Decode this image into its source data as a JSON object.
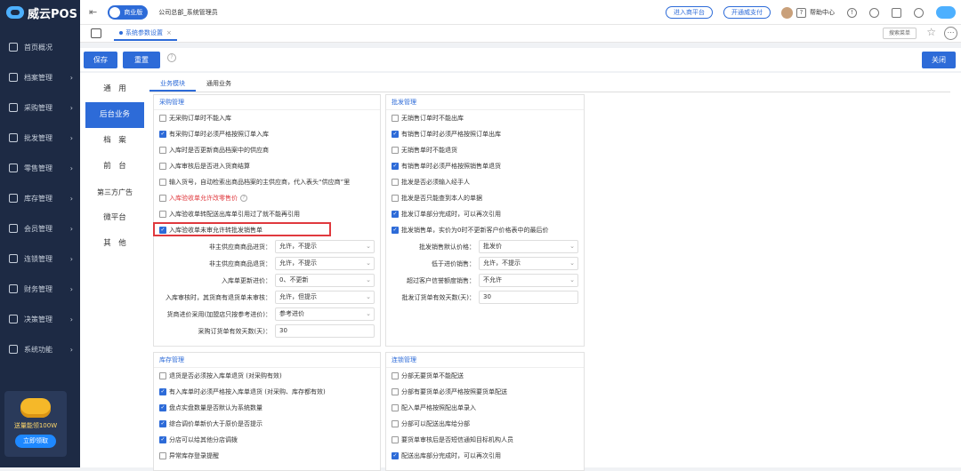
{
  "app": {
    "brand": "威云POS",
    "edition": "商业版",
    "org_user": "公司总部_系统管理员"
  },
  "topbar": {
    "pill_store": "进入商平台",
    "pill_pay": "开通威支付",
    "help": "帮助中心"
  },
  "sidebar": {
    "items": [
      {
        "label": "首页概况",
        "icon": "home-icon"
      },
      {
        "label": "档案管理",
        "icon": "archive-icon"
      },
      {
        "label": "采购管理",
        "icon": "cart-icon"
      },
      {
        "label": "批发管理",
        "icon": "wholesale-icon"
      },
      {
        "label": "零售管理",
        "icon": "retail-icon"
      },
      {
        "label": "库存管理",
        "icon": "inventory-icon"
      },
      {
        "label": "会员管理",
        "icon": "member-icon"
      },
      {
        "label": "连锁管理",
        "icon": "chain-icon"
      },
      {
        "label": "财务管理",
        "icon": "finance-icon"
      },
      {
        "label": "决策管理",
        "icon": "decision-icon"
      },
      {
        "label": "系统功能",
        "icon": "settings-icon"
      }
    ],
    "promo_text": "送量能领100W",
    "promo_btn": "立即领取"
  },
  "tabbar": {
    "tab": "系统参数设置",
    "menu_search": "搜索菜单"
  },
  "actions": {
    "save": "保存",
    "reset": "重置",
    "close": "关闭"
  },
  "leftnav": [
    "通　用",
    "后台业务",
    "档　案",
    "前　台",
    "第三方广告",
    "微平台",
    "其　他"
  ],
  "subtabs": [
    "业务模块",
    "通用业务"
  ],
  "purchase": {
    "title": "采购管理",
    "options": [
      {
        "label": "无采购订单时不能入库",
        "checked": false
      },
      {
        "label": "有采购订单时必须严格按照订单入库",
        "checked": true
      },
      {
        "label": "入库时是否更新商品档案中的供应商",
        "checked": false
      },
      {
        "label": "入库审核后是否进入货商结算",
        "checked": false
      },
      {
        "label": "输入货号，自动检索出商品档案的主供应商，代入表头“供应商”里",
        "checked": false
      },
      {
        "label": "入库验收单允许改零售价",
        "checked": false
      },
      {
        "label": "入库验收单转配送出库单引用过了就不能再引用",
        "checked": false
      },
      {
        "label": "入库验收单未审允许转批发销售单",
        "checked": true
      }
    ],
    "fields": [
      {
        "label": "非主供应商商品进货：",
        "value": "允许，不提示"
      },
      {
        "label": "非主供应商商品退货：",
        "value": "允许，不提示"
      },
      {
        "label": "入库单更新进价：",
        "value": "0、不更新"
      },
      {
        "label": "入库审核时，其货商有退货单未审核：",
        "value": "允许，但提示"
      },
      {
        "label": "货商进价采用(加盟店只按参考进价)：",
        "value": "参考进价"
      },
      {
        "label": "采购订货单有效天数(天)：",
        "value": "30"
      }
    ]
  },
  "wholesale": {
    "title": "批发管理",
    "options": [
      {
        "label": "无销售订单时不能出库",
        "checked": false
      },
      {
        "label": "有销售订单时必须严格按照订单出库",
        "checked": true
      },
      {
        "label": "无销售单时不能退货",
        "checked": false
      },
      {
        "label": "有销售单时必须严格按照销售单退货",
        "checked": true
      },
      {
        "label": "批发是否必须输入经手人",
        "checked": false
      },
      {
        "label": "批发是否只能查到本人的单据",
        "checked": false
      },
      {
        "label": "批发订单部分完成时，可以再次引用",
        "checked": true
      },
      {
        "label": "批发销售单，实价为0时不更新客户价格表中的最后价",
        "checked": true
      }
    ],
    "fields": [
      {
        "label": "批发销售默认价格：",
        "value": "批发价"
      },
      {
        "label": "低于进价销售：",
        "value": "允许，不提示"
      },
      {
        "label": "超过客户信誉额度销售：",
        "value": "不允许"
      },
      {
        "label": "批发订货单有效天数(天)：",
        "value": "30"
      }
    ]
  },
  "stock": {
    "title": "库存管理",
    "options": [
      {
        "label": "退货是否必须按入库单退货 (对采购有效)",
        "checked": false
      },
      {
        "label": "有入库单时必须严格按入库单退货 (对采购、库存都有效)",
        "checked": true
      },
      {
        "label": "盘点实盘数量是否默认为系统数量",
        "checked": true
      },
      {
        "label": "综合调价单新价大于原价是否提示",
        "checked": true
      },
      {
        "label": "分店可以给其他分店调拨",
        "checked": true
      },
      {
        "label": "异常库存登录提醒",
        "checked": false
      }
    ]
  },
  "chain": {
    "title": "连锁管理",
    "options": [
      {
        "label": "分部无要货单不能配送",
        "checked": false
      },
      {
        "label": "分部有要货单必须严格按照要货单配送",
        "checked": false
      },
      {
        "label": "配入单严格按照配出单录入",
        "checked": false
      },
      {
        "label": "分部可以配送出库给分部",
        "checked": false
      },
      {
        "label": "要货单审核后是否短信通知目标机构人员",
        "checked": false
      },
      {
        "label": "配送出库部分完成时，可以再次引用",
        "checked": true
      }
    ]
  }
}
